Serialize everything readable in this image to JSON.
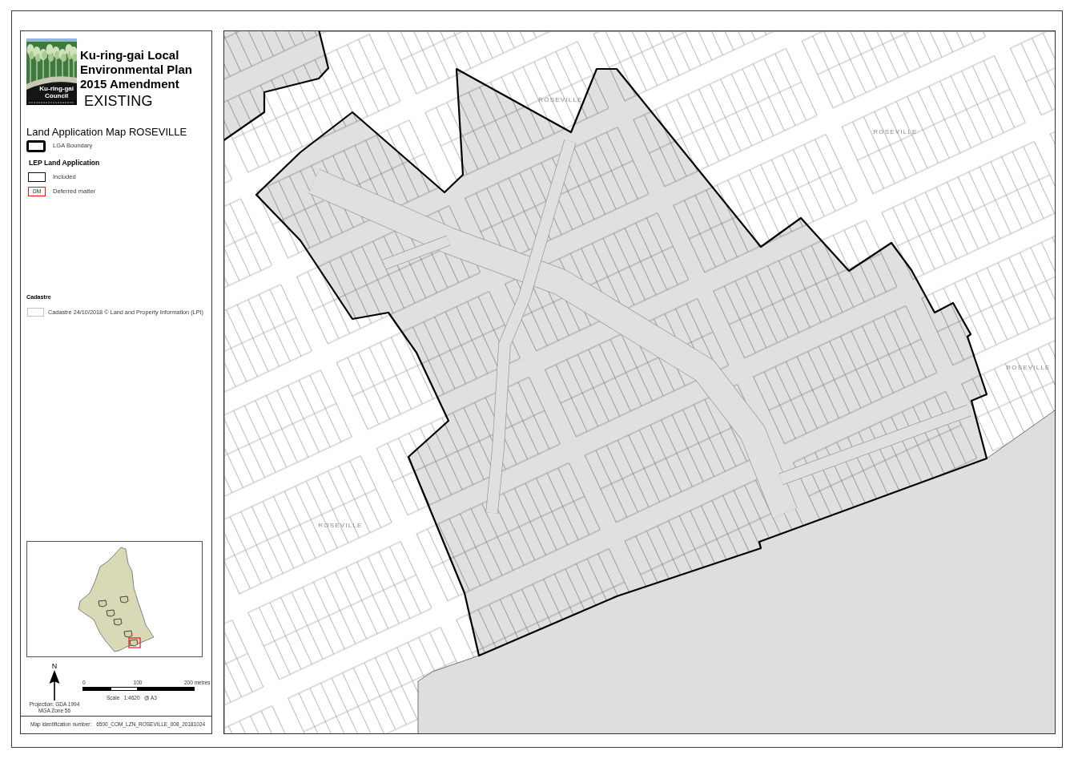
{
  "legend": {
    "logo_text": "Ku-ring-gai\nCouncil",
    "title": "Ku-ring-gai Local\nEnvironmental Plan\n2015 Amendment",
    "status": "EXISTING",
    "map_title": "Land Application Map ROSEVILLE",
    "items": [
      {
        "kind": "boundary",
        "label": "LGA Boundary"
      }
    ],
    "sections": [
      {
        "heading": "LEP Land Application",
        "items": [
          {
            "kind": "included",
            "label": "Included"
          },
          {
            "kind": "deferred",
            "swatch_text": "DM",
            "label": "Deferred matter"
          }
        ]
      },
      {
        "heading": "Cadastre",
        "items": [
          {
            "kind": "cadastre",
            "label": "Cadastre 24/10/2018 © Land and Property Information (LPI)"
          }
        ]
      }
    ]
  },
  "north_label": "N",
  "projection": "Projection: GDA 1994\nMGA Zone 56",
  "scale_bar": {
    "labels": [
      "0",
      "100",
      "200 metres"
    ],
    "text": "Scale   1:4620   @ A3"
  },
  "map_id": {
    "label": "Map identification number:",
    "value": "6500_COM_LZN_ROSEVILLE_008_20181024"
  },
  "map": {
    "place_labels": [
      "ROSEVILLE",
      "ROSEVILLE",
      "ROSEVILLE",
      "ROSEVILLE"
    ]
  }
}
